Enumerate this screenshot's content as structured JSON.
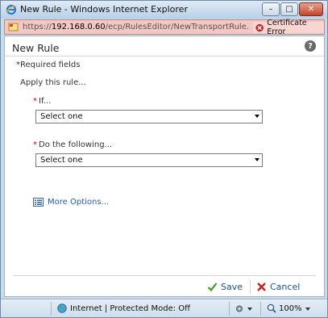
{
  "window": {
    "title": "New Rule - Windows Internet Explorer",
    "minimize_glyph": "–",
    "maximize_glyph": "□",
    "close_glyph": "✕"
  },
  "address": {
    "scheme": "https://",
    "host": "192.168.0.60",
    "path": "/ecp/RulesEditor/NewTransportRule.aspx?pwn",
    "certificate_label": "Certificate Error"
  },
  "page": {
    "title": "New Rule",
    "help_glyph": "?",
    "required_note": "*Required fields",
    "apply_text": "Apply this rule..."
  },
  "fields": {
    "if_star": "*",
    "if_label": "If...",
    "if_value": "Select one",
    "do_star": "*",
    "do_label": "Do the following...",
    "do_value": "Select one"
  },
  "more_options": "More Options...",
  "buttons": {
    "save": "Save",
    "cancel": "Cancel"
  },
  "statusbar": {
    "zone": "Internet | Protected Mode: Off",
    "zoom": "100%"
  },
  "colors": {
    "link": "#2a5aa8",
    "address_error": "#f4c7c4",
    "save_icon": "#3a9a2a",
    "cancel_icon": "#c62020"
  }
}
